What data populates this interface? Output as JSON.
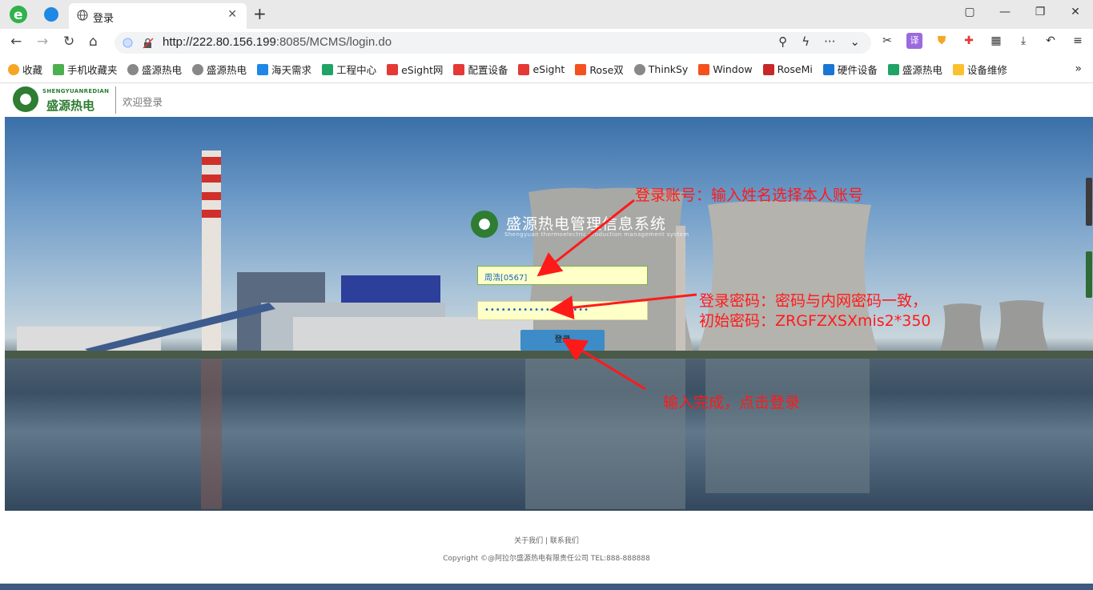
{
  "browser": {
    "tab_title": "登录",
    "tab_close": "✕",
    "new_tab": "+",
    "url_host": "http://222.80.156.199",
    "url_path": ":8085/MCMS/login.do",
    "window_controls": [
      "▢",
      "—",
      "❐",
      "✕"
    ]
  },
  "bookmarks": {
    "items": [
      {
        "label": "收藏",
        "icon": "star-icon",
        "color": "#f5a623"
      },
      {
        "label": "手机收藏夹",
        "icon": "phone-icon",
        "color": "#4caf50"
      },
      {
        "label": "盛源热电",
        "icon": "globe-icon",
        "color": "#888888"
      },
      {
        "label": "盛源热电",
        "icon": "globe-icon",
        "color": "#888888"
      },
      {
        "label": "海天需求",
        "icon": "sky-icon",
        "color": "#1e88e5"
      },
      {
        "label": "工程中心",
        "icon": "sheet-icon",
        "color": "#21a366"
      },
      {
        "label": "eSight网",
        "icon": "huawei-icon",
        "color": "#e53935"
      },
      {
        "label": "配置设备",
        "icon": "huawei-icon",
        "color": "#e53935"
      },
      {
        "label": "eSight",
        "icon": "huawei-icon",
        "color": "#e53935"
      },
      {
        "label": "Rose双",
        "icon": "c-icon",
        "color": "#f4511e"
      },
      {
        "label": "ThinkSy",
        "icon": "globe-icon",
        "color": "#888888"
      },
      {
        "label": "Window",
        "icon": "c-icon",
        "color": "#f4511e"
      },
      {
        "label": "RoseMi",
        "icon": "r-icon",
        "color": "#c62828"
      },
      {
        "label": "硬件设备",
        "icon": "person-icon",
        "color": "#1976d2"
      },
      {
        "label": "盛源热电",
        "icon": "sheet-icon",
        "color": "#21a366"
      },
      {
        "label": "设备维修",
        "icon": "q-icon",
        "color": "#fbc02d"
      }
    ],
    "more": "»"
  },
  "header": {
    "logo_en": "SHENGYUANREDIAN",
    "logo_cn": "盛源热电",
    "welcome": "欢迎登录"
  },
  "login": {
    "system_title": "盛源热电管理信息系统",
    "system_subtitle": "Shengyuan thermoelectric production management system",
    "username_value": "周浩[0567]",
    "password_value": "•••••••••••••••••••",
    "login_button": "登录"
  },
  "annotations": {
    "user_note": "登录账号：输入姓名选择本人账号",
    "pass_note_line1": "登录密码：密码与内网密码一致，",
    "pass_note_line2": "初始密码：ZRGFZXSXmis2*350",
    "done_note": "输入完成，点击登录"
  },
  "footer": {
    "about": "关于我们",
    "separator": "|",
    "contact": "联系我们",
    "copyright": "Copyright ©@阿拉尔盛源热电有限责任公司  TEL:888-888888"
  },
  "colors": {
    "annotation": "#ff1a1a",
    "brand_green": "#2e7d32",
    "button_blue": "#3d8cc7"
  }
}
